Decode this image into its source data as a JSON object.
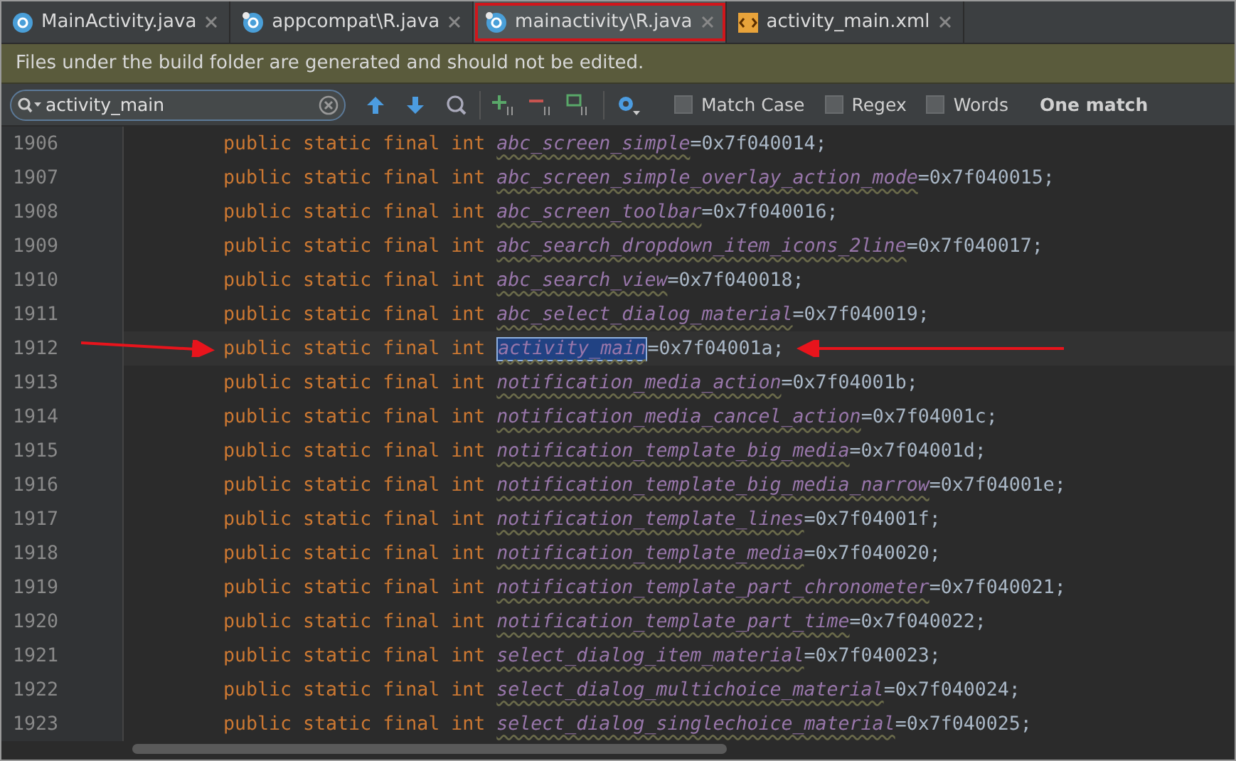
{
  "tabs": [
    {
      "label": "MainActivity.java",
      "kind": "class",
      "selected": false,
      "outlined": false
    },
    {
      "label": "appcompat\\R.java",
      "kind": "generated",
      "selected": false,
      "outlined": false
    },
    {
      "label": "mainactivity\\R.java",
      "kind": "generated",
      "selected": true,
      "outlined": true
    },
    {
      "label": "activity_main.xml",
      "kind": "xml",
      "selected": false,
      "outlined": false
    }
  ],
  "banner": "Files under the build folder are generated and should not be edited.",
  "search": {
    "value": "activity_main",
    "options": [
      {
        "label": "Match Case",
        "checked": false
      },
      {
        "label": "Regex",
        "checked": false
      },
      {
        "label": "Words",
        "checked": false
      }
    ],
    "result": "One match"
  },
  "lines": [
    {
      "number": "1906",
      "modifiers": "public static final int",
      "name": "abc_screen_simple",
      "value": "=0x7f040014;",
      "match": false
    },
    {
      "number": "1907",
      "modifiers": "public static final int",
      "name": "abc_screen_simple_overlay_action_mode",
      "value": "=0x7f040015;",
      "match": false
    },
    {
      "number": "1908",
      "modifiers": "public static final int",
      "name": "abc_screen_toolbar",
      "value": "=0x7f040016;",
      "match": false
    },
    {
      "number": "1909",
      "modifiers": "public static final int",
      "name": "abc_search_dropdown_item_icons_2line",
      "value": "=0x7f040017;",
      "match": false
    },
    {
      "number": "1910",
      "modifiers": "public static final int",
      "name": "abc_search_view",
      "value": "=0x7f040018;",
      "match": false
    },
    {
      "number": "1911",
      "modifiers": "public static final int",
      "name": "abc_select_dialog_material",
      "value": "=0x7f040019;",
      "match": false
    },
    {
      "number": "1912",
      "modifiers": "public static final int",
      "name": "activity_main",
      "value": "=0x7f04001a;",
      "match": true
    },
    {
      "number": "1913",
      "modifiers": "public static final int",
      "name": "notification_media_action",
      "value": "=0x7f04001b;",
      "match": false
    },
    {
      "number": "1914",
      "modifiers": "public static final int",
      "name": "notification_media_cancel_action",
      "value": "=0x7f04001c;",
      "match": false
    },
    {
      "number": "1915",
      "modifiers": "public static final int",
      "name": "notification_template_big_media",
      "value": "=0x7f04001d;",
      "match": false
    },
    {
      "number": "1916",
      "modifiers": "public static final int",
      "name": "notification_template_big_media_narrow",
      "value": "=0x7f04001e;",
      "match": false
    },
    {
      "number": "1917",
      "modifiers": "public static final int",
      "name": "notification_template_lines",
      "value": "=0x7f04001f;",
      "match": false
    },
    {
      "number": "1918",
      "modifiers": "public static final int",
      "name": "notification_template_media",
      "value": "=0x7f040020;",
      "match": false
    },
    {
      "number": "1919",
      "modifiers": "public static final int",
      "name": "notification_template_part_chronometer",
      "value": "=0x7f040021;",
      "match": false
    },
    {
      "number": "1920",
      "modifiers": "public static final int",
      "name": "notification_template_part_time",
      "value": "=0x7f040022;",
      "match": false
    },
    {
      "number": "1921",
      "modifiers": "public static final int",
      "name": "select_dialog_item_material",
      "value": "=0x7f040023;",
      "match": false
    },
    {
      "number": "1922",
      "modifiers": "public static final int",
      "name": "select_dialog_multichoice_material",
      "value": "=0x7f040024;",
      "match": false
    },
    {
      "number": "1923",
      "modifiers": "public static final int",
      "name": "select_dialog_singlechoice_material",
      "value": "=0x7f040025;",
      "match": false
    }
  ]
}
